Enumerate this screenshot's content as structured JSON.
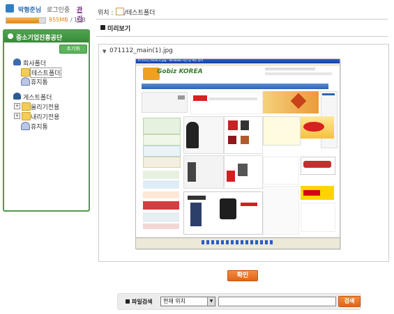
{
  "user": {
    "name": "박형준님",
    "login_status": "로그인중",
    "admin_link": "관리",
    "quota_used": "855MB",
    "quota_separator": "/",
    "quota_total": "1GB",
    "quota_fraction": 0.835
  },
  "sidebar": {
    "org_name": "중소기업진흥공단",
    "init_button": "초기화",
    "company_folder": "회사폴더",
    "test_folder": "테스트폴더",
    "trash_1": "휴지통",
    "guest_folder": "게스트폴더",
    "upload_folder": "올리기전용",
    "download_folder": "내리기전용",
    "trash_2": "휴지통"
  },
  "location": {
    "label": "위치 :",
    "path": "/테스트폴더"
  },
  "preview": {
    "title": "미리보기",
    "file_name": "071112_main(1).jpg",
    "image_window_title": "071112_main(1).jpg - Windows 사진 및 팩스 뷰어",
    "image_logo": "Gobiz KOREA"
  },
  "confirm_button": "확인",
  "search": {
    "label": "파일검색",
    "scope_value": "현재 위치",
    "input_value": "",
    "button": "검색"
  },
  "colors": {
    "panel_green": "#4d9a4d",
    "accent_orange": "#e0651a",
    "quota_orange": "#e08020"
  }
}
